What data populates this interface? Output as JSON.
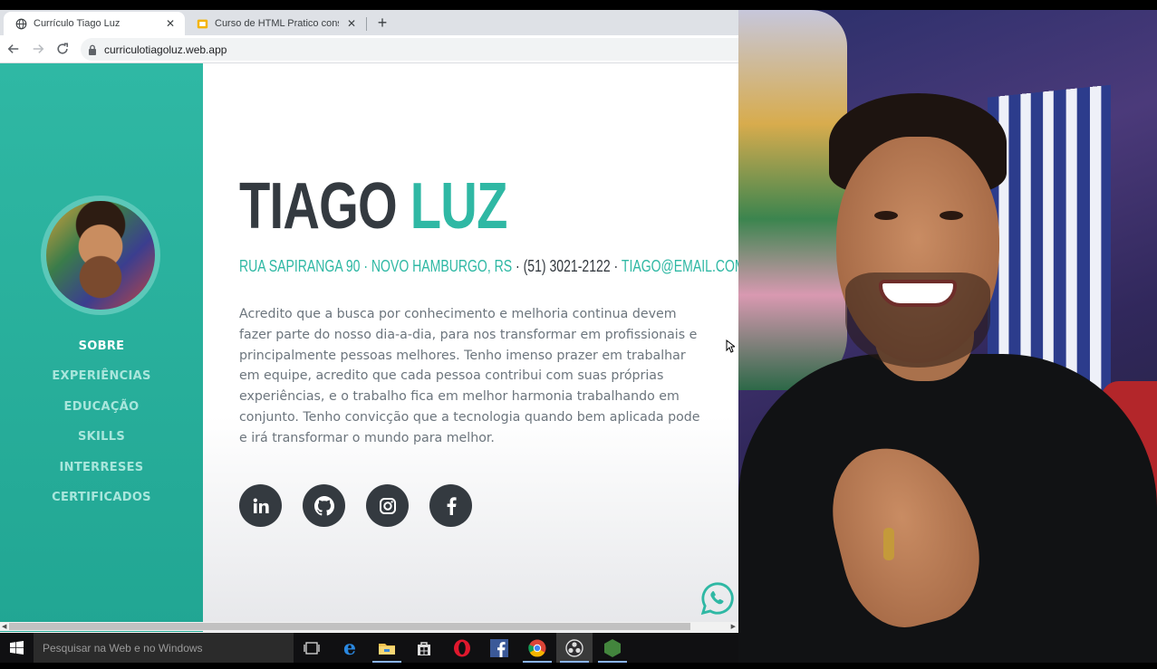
{
  "browser": {
    "tabs": [
      {
        "title": "Currículo Tiago Luz",
        "active": true,
        "icon": "globe-icon"
      },
      {
        "title": "Curso de HTML Pratico constru",
        "active": false,
        "icon": "slides-icon"
      }
    ],
    "new_tab_label": "+",
    "url": "curriculotiagoluz.web.app"
  },
  "site": {
    "nav": [
      {
        "label": "SOBRE",
        "active": true
      },
      {
        "label": "EXPERIÊNCIAS",
        "active": false
      },
      {
        "label": "EDUCAÇÃO",
        "active": false
      },
      {
        "label": "SKILLS",
        "active": false
      },
      {
        "label": "INTERRESES",
        "active": false
      },
      {
        "label": "CERTIFICADOS",
        "active": false
      }
    ],
    "name_first": "TIAGO",
    "name_last": "LUZ",
    "address": "RUA SAPIRANGA 90 · NOVO HAMBURGO, RS",
    "sep1": " · ",
    "phone": "(51) 3021-2122",
    "sep2": " · ",
    "email": "TIAGO@EMAIL.COM",
    "bio": "Acredito que a busca por conhecimento e melhoria continua devem fazer parte do nosso dia-a-dia, para nos transformar em profissionais e principalmente pessoas melhores. Tenho imenso prazer em trabalhar em equipe, acredito que cada pessoa contribui com suas próprias experiências, e o trabalho fica em melhor harmonia trabalhando em conjunto. Tenho convicção que a tecnologia quando bem aplicada pode e irá transformar o mundo para melhor.",
    "social_icons": [
      "linkedin-icon",
      "github-icon",
      "instagram-icon",
      "facebook-icon"
    ],
    "accent_color": "#2fb8a4",
    "dark_color": "#343a40"
  },
  "taskbar": {
    "search_placeholder": "Pesquisar na Web e no Windows",
    "apps": [
      "task-view-icon",
      "edge-icon",
      "file-explorer-icon",
      "store-icon",
      "opera-icon",
      "facebook-icon",
      "chrome-icon",
      "obs-icon",
      "nodejs-icon"
    ]
  }
}
